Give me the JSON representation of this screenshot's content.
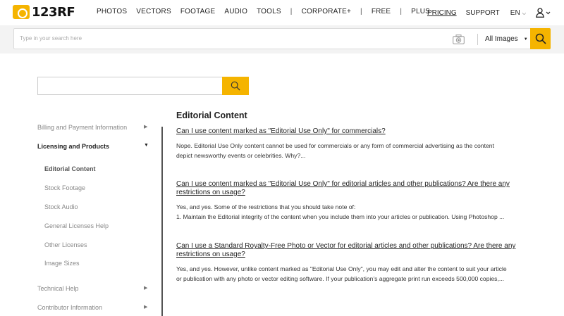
{
  "header": {
    "logo_text": "123RF",
    "nav": [
      "PHOTOS",
      "VECTORS",
      "FOOTAGE",
      "AUDIO",
      "TOOLS"
    ],
    "nav_extra": [
      "CORPORATE+",
      "FREE",
      "PLUS"
    ],
    "separator": "|",
    "pricing": "PRICING",
    "support": "SUPPORT",
    "language": "EN",
    "accent_color": "#f5b400"
  },
  "search": {
    "placeholder": "Type in your search here",
    "category": "All Images"
  },
  "sidebar": {
    "items": [
      {
        "label": "Billing and Payment Information"
      },
      {
        "label": "Licensing and Products"
      },
      {
        "label": "Technical Help"
      },
      {
        "label": "Contributor Information"
      }
    ],
    "subitems": [
      "Editorial Content",
      "Stock Footage",
      "Stock Audio",
      "General Licenses Help",
      "Other Licenses",
      "Image Sizes"
    ]
  },
  "content": {
    "title": "Editorial Content",
    "faqs": [
      {
        "question": "Can I use content marked as \"Editorial Use Only\" for commercials?",
        "answer_lines": [
          "Nope. Editorial Use Only content cannot be used for commercials or any form of commercial advertising as the content",
          "depict newsworthy events or celebrities. Why?..."
        ]
      },
      {
        "question_lines": [
          "Can I use content marked as \"Editorial Use Only\" for editorial articles and other publications? Are there any",
          "restrictions on usage?"
        ],
        "answer_lines": [
          "Yes, and yes. Some of the restrictions that you should take note of:",
          "1. Maintain the Editorial integrity of the content when you include them into your articles or publication. Using Photoshop ..."
        ]
      },
      {
        "question_lines": [
          "Can I use a Standard Royalty-Free Photo or Vector for editorial articles and other publications? Are there any",
          "restrictions on usage?"
        ],
        "answer_lines": [
          "Yes, and yes. However, unlike content marked as \"Editorial Use Only\", you may edit and alter the content to suit your article",
          "or publication with any photo or vector editing software. If your publication's aggregate print run exceeds 500,000 copies,..."
        ]
      }
    ]
  }
}
